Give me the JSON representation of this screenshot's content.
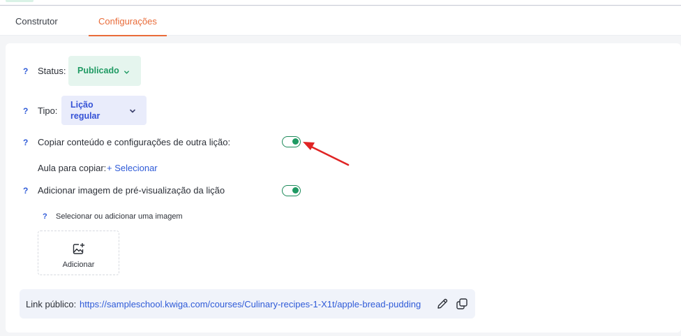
{
  "tabs": [
    {
      "label": "Construtor",
      "active": false
    },
    {
      "label": "Configurações",
      "active": true
    }
  ],
  "help_symbol": "?",
  "status": {
    "label": "Status:",
    "value": "Publicado"
  },
  "type": {
    "label": "Tipo:",
    "value": "Lição regular"
  },
  "copy_content": {
    "label": "Copiar conteúdo e configurações de outra lição:",
    "enabled": true
  },
  "lesson_to_copy": {
    "label": "Aula para copiar:",
    "link": "+ Selecionar"
  },
  "preview_image": {
    "label": "Adicionar imagem de pré-visualização da lição",
    "enabled": true
  },
  "image_select": {
    "label": "Selecionar ou adicionar uma imagem",
    "button": "Adicionar"
  },
  "public_link": {
    "label": "Link público:",
    "url": "https://sampleschool.kwiga.com/courses/Culinary-recipes-1-X1t/apple-bread-pudding"
  },
  "icons": [
    "chevron-down-icon",
    "image-add-icon",
    "pencil-icon",
    "copy-icon",
    "red-arrow-annotation"
  ],
  "colors": {
    "accent": "#e96c3a",
    "link": "#2f5bd8",
    "success": "#1f9a63",
    "annotation": "#e02424"
  }
}
